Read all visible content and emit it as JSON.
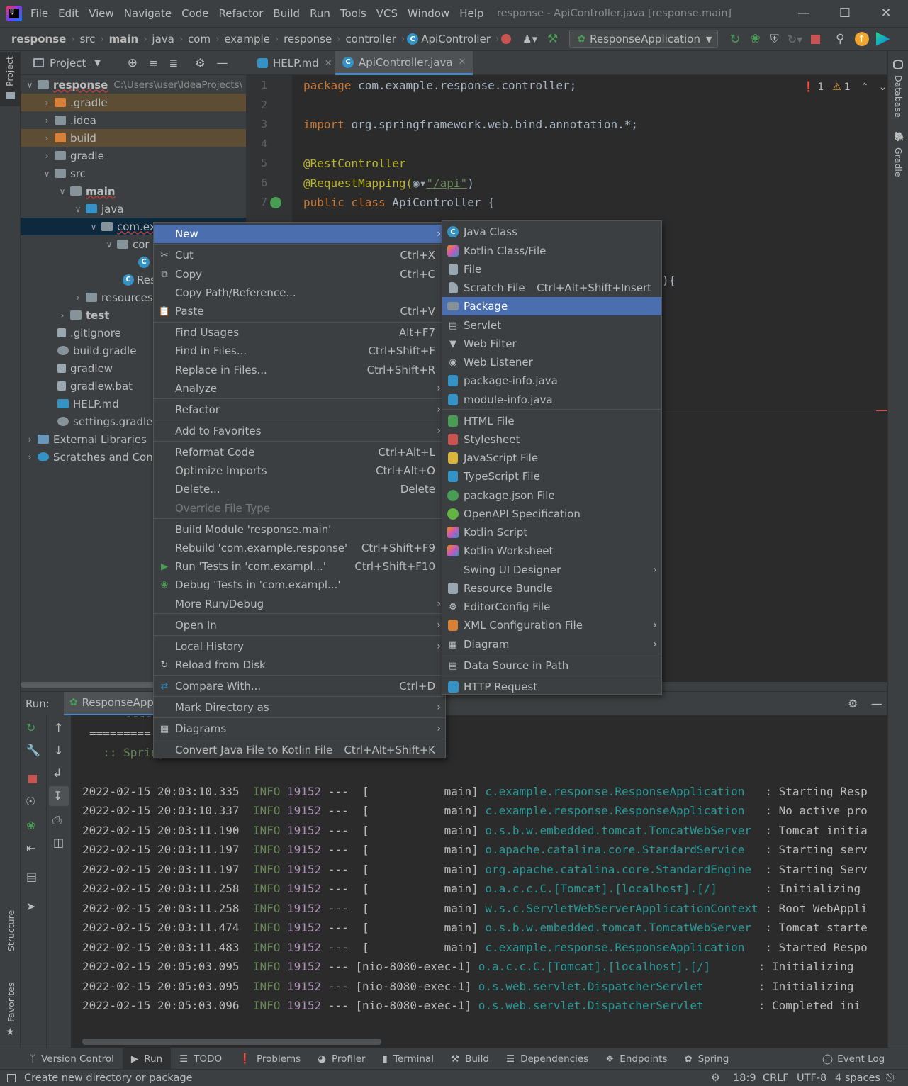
{
  "menubar": [
    "File",
    "Edit",
    "View",
    "Navigate",
    "Code",
    "Refactor",
    "Build",
    "Run",
    "Tools",
    "VCS",
    "Window",
    "Help"
  ],
  "window_title": "response - ApiController.java [response.main]",
  "breadcrumbs": [
    "response",
    "src",
    "main",
    "java",
    "com",
    "example",
    "response",
    "controller",
    "ApiController"
  ],
  "run_config": "ResponseApplication",
  "side_left": {
    "project": "Project",
    "structure": "Structure",
    "favorites": "Favorites"
  },
  "side_right": {
    "database": "Database",
    "gradle": "Gradle"
  },
  "project_panel": {
    "title": "Project"
  },
  "tree": [
    {
      "label": "response",
      "extra": "C:\\Users\\user\\IdeaProjects\\",
      "bold": true
    },
    {
      "label": ".gradle"
    },
    {
      "label": ".idea"
    },
    {
      "label": "build"
    },
    {
      "label": "gradle"
    },
    {
      "label": "src"
    },
    {
      "label": "main",
      "bold": true
    },
    {
      "label": "java"
    },
    {
      "label": "com.ex"
    },
    {
      "label": "cor"
    },
    {
      "label": ""
    },
    {
      "label": "Res"
    },
    {
      "label": "resources"
    },
    {
      "label": "test",
      "bold": true
    },
    {
      "label": ".gitignore"
    },
    {
      "label": "build.gradle"
    },
    {
      "label": "gradlew"
    },
    {
      "label": "gradlew.bat"
    },
    {
      "label": "HELP.md"
    },
    {
      "label": "settings.gradle"
    },
    {
      "label": "External Libraries"
    },
    {
      "label": "Scratches and Cons"
    }
  ],
  "editor_tabs": [
    {
      "label": "HELP.md"
    },
    {
      "label": "ApiController.java"
    }
  ],
  "inspection": {
    "errors": "1",
    "warnings": "1"
  },
  "line_numbers": [
    "1",
    "2",
    "3",
    "4",
    "5",
    "6",
    "7"
  ],
  "code": {
    "l1_kw": "package ",
    "l1_rest": "com.example.response.controller;",
    "l3_kw": "import ",
    "l3_rest": "org.springframework.web.bind.annotation.*;",
    "l5": "@RestController",
    "l6_an": "@RequestMapping(",
    "l6_str": "\"/api\"",
    "l6_end": ")",
    "l7_kw": "public class ",
    "l7_rest": "ApiController {",
    "frag": "){"
  },
  "run": {
    "label": "Run:",
    "tab": "ResponseAppli"
  },
  "console_header": [
    "  '-----",
    "=========",
    "  :: Spring"
  ],
  "log": [
    {
      "ts": "2022-02-15 20:03:10.335",
      "lvl": "INFO",
      "pid": "19152",
      "thr": "---  [           main]",
      "cls": "c.example.response.ResponseApplication  ",
      "msg": " : Starting Resp"
    },
    {
      "ts": "2022-02-15 20:03:10.337",
      "lvl": "INFO",
      "pid": "19152",
      "thr": "---  [           main]",
      "cls": "c.example.response.ResponseApplication  ",
      "msg": " : No active pro"
    },
    {
      "ts": "2022-02-15 20:03:11.190",
      "lvl": "INFO",
      "pid": "19152",
      "thr": "---  [           main]",
      "cls": "o.s.b.w.embedded.tomcat.TomcatWebServer ",
      "msg": " : Tomcat initia"
    },
    {
      "ts": "2022-02-15 20:03:11.197",
      "lvl": "INFO",
      "pid": "19152",
      "thr": "---  [           main]",
      "cls": "o.apache.catalina.core.StandardService  ",
      "msg": " : Starting serv"
    },
    {
      "ts": "2022-02-15 20:03:11.197",
      "lvl": "INFO",
      "pid": "19152",
      "thr": "---  [           main]",
      "cls": "org.apache.catalina.core.StandardEngine ",
      "msg": " : Starting Serv"
    },
    {
      "ts": "2022-02-15 20:03:11.258",
      "lvl": "INFO",
      "pid": "19152",
      "thr": "---  [           main]",
      "cls": "o.a.c.c.C.[Tomcat].[localhost].[/]      ",
      "msg": " : Initializing "
    },
    {
      "ts": "2022-02-15 20:03:11.258",
      "lvl": "INFO",
      "pid": "19152",
      "thr": "---  [           main]",
      "cls": "w.s.c.ServletWebServerApplicationContext",
      "msg": " : Root WebAppli"
    },
    {
      "ts": "2022-02-15 20:03:11.474",
      "lvl": "INFO",
      "pid": "19152",
      "thr": "---  [           main]",
      "cls": "o.s.b.w.embedded.tomcat.TomcatWebServer ",
      "msg": " : Tomcat starte"
    },
    {
      "ts": "2022-02-15 20:03:11.483",
      "lvl": "INFO",
      "pid": "19152",
      "thr": "---  [           main]",
      "cls": "c.example.response.ResponseApplication  ",
      "msg": " : Started Respo"
    },
    {
      "ts": "2022-02-15 20:05:03.095",
      "lvl": "INFO",
      "pid": "19152",
      "thr": "--- [nio-8080-exec-1]",
      "cls": "o.a.c.c.C.[Tomcat].[localhost].[/]      ",
      "msg": " : Initializing "
    },
    {
      "ts": "2022-02-15 20:05:03.095",
      "lvl": "INFO",
      "pid": "19152",
      "thr": "--- [nio-8080-exec-1]",
      "cls": "o.s.web.servlet.DispatcherServlet       ",
      "msg": " : Initializing "
    },
    {
      "ts": "2022-02-15 20:05:03.096",
      "lvl": "INFO",
      "pid": "19152",
      "thr": "--- [nio-8080-exec-1]",
      "cls": "o.s.web.servlet.DispatcherServlet       ",
      "msg": " : Completed ini"
    }
  ],
  "bottom_tabs": [
    "Version Control",
    "Run",
    "TODO",
    "Problems",
    "Profiler",
    "Terminal",
    "Build",
    "Dependencies",
    "Endpoints",
    "Spring",
    "Event Log"
  ],
  "status": {
    "message": "Create new directory or package",
    "position": "18:9",
    "line_sep": "CRLF",
    "encoding": "UTF-8",
    "indent": "4 spaces"
  },
  "context_menu": [
    {
      "label": "New",
      "shortcut": "",
      "sub": true
    },
    {
      "label": "Cut",
      "shortcut": "Ctrl+X"
    },
    {
      "label": "Copy",
      "shortcut": "Ctrl+C"
    },
    {
      "label": "Copy Path/Reference...",
      "shortcut": ""
    },
    {
      "label": "Paste",
      "shortcut": "Ctrl+V"
    },
    {
      "label": "Find Usages",
      "shortcut": "Alt+F7"
    },
    {
      "label": "Find in Files...",
      "shortcut": "Ctrl+Shift+F"
    },
    {
      "label": "Replace in Files...",
      "shortcut": "Ctrl+Shift+R"
    },
    {
      "label": "Analyze",
      "shortcut": "",
      "sub": true
    },
    {
      "label": "Refactor",
      "shortcut": "",
      "sub": true
    },
    {
      "label": "Add to Favorites",
      "shortcut": "",
      "sub": true
    },
    {
      "label": "Reformat Code",
      "shortcut": "Ctrl+Alt+L"
    },
    {
      "label": "Optimize Imports",
      "shortcut": "Ctrl+Alt+O"
    },
    {
      "label": "Delete...",
      "shortcut": "Delete"
    },
    {
      "label": "Override File Type",
      "shortcut": ""
    },
    {
      "label": "Build Module 'response.main'",
      "shortcut": ""
    },
    {
      "label": "Rebuild 'com.example.response'",
      "shortcut": "Ctrl+Shift+F9"
    },
    {
      "label": "Run 'Tests in 'com.exampl...'",
      "shortcut": "Ctrl+Shift+F10"
    },
    {
      "label": "Debug 'Tests in 'com.exampl...'",
      "shortcut": ""
    },
    {
      "label": "More Run/Debug",
      "shortcut": "",
      "sub": true
    },
    {
      "label": "Open In",
      "shortcut": "",
      "sub": true
    },
    {
      "label": "Local History",
      "shortcut": "",
      "sub": true
    },
    {
      "label": "Reload from Disk",
      "shortcut": ""
    },
    {
      "label": "Compare With...",
      "shortcut": "Ctrl+D"
    },
    {
      "label": "Mark Directory as",
      "shortcut": "",
      "sub": true
    },
    {
      "label": "Diagrams",
      "shortcut": "",
      "sub": true
    },
    {
      "label": "Convert Java File to Kotlin File",
      "shortcut": "Ctrl+Alt+Shift+K"
    }
  ],
  "new_submenu": [
    {
      "label": "Java Class",
      "shortcut": ""
    },
    {
      "label": "Kotlin Class/File",
      "shortcut": ""
    },
    {
      "label": "File",
      "shortcut": ""
    },
    {
      "label": "Scratch File",
      "shortcut": "Ctrl+Alt+Shift+Insert"
    },
    {
      "label": "Package",
      "shortcut": ""
    },
    {
      "label": "Servlet",
      "shortcut": ""
    },
    {
      "label": "Web Filter",
      "shortcut": ""
    },
    {
      "label": "Web Listener",
      "shortcut": ""
    },
    {
      "label": "package-info.java",
      "shortcut": ""
    },
    {
      "label": "module-info.java",
      "shortcut": ""
    },
    {
      "label": "HTML File",
      "shortcut": ""
    },
    {
      "label": "Stylesheet",
      "shortcut": ""
    },
    {
      "label": "JavaScript File",
      "shortcut": ""
    },
    {
      "label": "TypeScript File",
      "shortcut": ""
    },
    {
      "label": "package.json File",
      "shortcut": ""
    },
    {
      "label": "OpenAPI Specification",
      "shortcut": ""
    },
    {
      "label": "Kotlin Script",
      "shortcut": ""
    },
    {
      "label": "Kotlin Worksheet",
      "shortcut": ""
    },
    {
      "label": "Swing UI Designer",
      "shortcut": "",
      "sub": true
    },
    {
      "label": "Resource Bundle",
      "shortcut": ""
    },
    {
      "label": "EditorConfig File",
      "shortcut": ""
    },
    {
      "label": "XML Configuration File",
      "shortcut": "",
      "sub": true
    },
    {
      "label": "Diagram",
      "shortcut": "",
      "sub": true
    },
    {
      "label": "Data Source in Path",
      "shortcut": ""
    },
    {
      "label": "HTTP Request",
      "shortcut": ""
    }
  ],
  "colors": {
    "selection": "#4b6eaf",
    "panel": "#3c3f41",
    "editor": "#2b2b2b",
    "keyword": "#cc7832",
    "annotation": "#bbb529",
    "string": "#6a8759",
    "log_class": "#299999",
    "log_pid": "#b294bb"
  }
}
